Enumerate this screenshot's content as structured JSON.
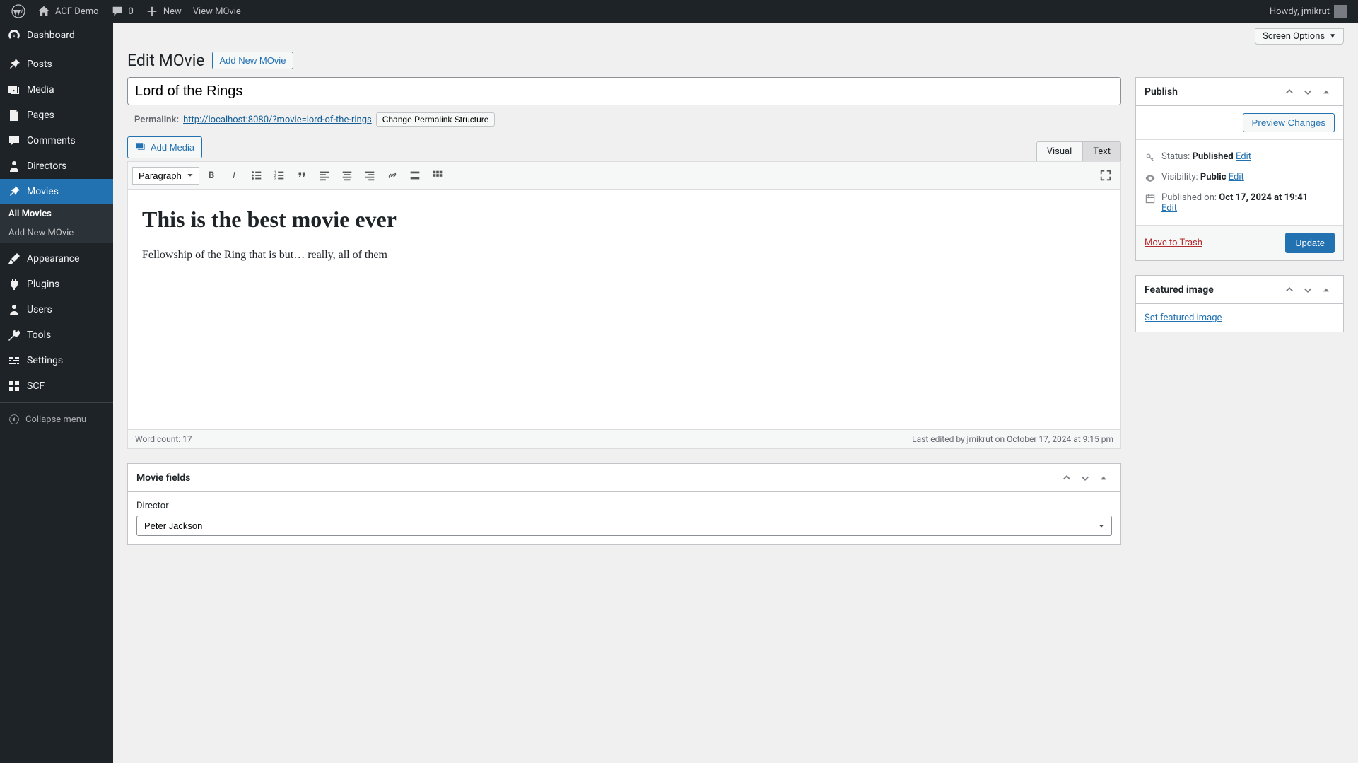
{
  "adminbar": {
    "site_name": "ACF Demo",
    "comments_count": "0",
    "new_label": "New",
    "view_label": "View MOvie",
    "howdy": "Howdy, jmikrut"
  },
  "sidebar": {
    "items": [
      {
        "icon": "dashboard",
        "label": "Dashboard"
      },
      {
        "icon": "pin",
        "label": "Posts"
      },
      {
        "icon": "media",
        "label": "Media"
      },
      {
        "icon": "page",
        "label": "Pages"
      },
      {
        "icon": "comment",
        "label": "Comments"
      },
      {
        "icon": "person",
        "label": "Directors"
      },
      {
        "icon": "pin",
        "label": "Movies",
        "current": true
      },
      {
        "icon": "brush",
        "label": "Appearance"
      },
      {
        "icon": "plug",
        "label": "Plugins"
      },
      {
        "icon": "user",
        "label": "Users"
      },
      {
        "icon": "wrench",
        "label": "Tools"
      },
      {
        "icon": "sliders",
        "label": "Settings"
      },
      {
        "icon": "grid",
        "label": "SCF"
      }
    ],
    "submenu": [
      {
        "label": "All Movies",
        "active": true
      },
      {
        "label": "Add New MOvie"
      }
    ],
    "collapse": "Collapse menu"
  },
  "screen_options": "Screen Options",
  "header": {
    "title": "Edit MOvie",
    "action": "Add New MOvie"
  },
  "post": {
    "title": "Lord of the Rings",
    "permalink_label": "Permalink:",
    "permalink_url": "http://localhost:8080/?movie=lord-of-the-rings",
    "permalink_btn": "Change Permalink Structure",
    "add_media": "Add Media"
  },
  "editor": {
    "tabs": {
      "visual": "Visual",
      "text": "Text"
    },
    "format": "Paragraph",
    "content_heading": "This is the best movie ever",
    "content_p": "Fellowship of the Ring that is but… really, all of them",
    "word_count_label": "Word count: 17",
    "last_edited": "Last edited by jmikrut on October 17, 2024 at 9:15 pm"
  },
  "publish": {
    "title": "Publish",
    "preview": "Preview Changes",
    "status_label": "Status:",
    "status_value": "Published",
    "visibility_label": "Visibility:",
    "visibility_value": "Public",
    "published_label": "Published on:",
    "published_value": "Oct 17, 2024 at 19:41",
    "edit": "Edit",
    "trash": "Move to Trash",
    "update": "Update"
  },
  "featured": {
    "title": "Featured image",
    "set": "Set featured image"
  },
  "movie_fields": {
    "title": "Movie fields",
    "director_label": "Director",
    "director_value": "Peter Jackson"
  }
}
